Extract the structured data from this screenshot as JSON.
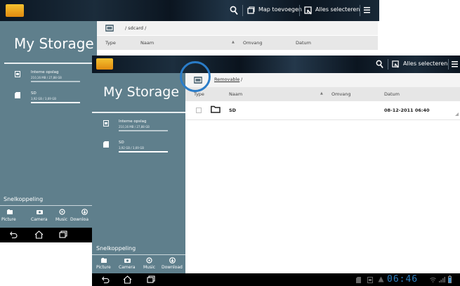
{
  "back": {
    "app_bar": {
      "action_add_folder": "Map toevoegen",
      "action_select_all": "Alles selecteren"
    },
    "sidebar": {
      "title": "My Storage",
      "storage": [
        {
          "label": "Interne opslag",
          "size": "210,16 MB / 27,88 GB",
          "fill": 0.01
        },
        {
          "label": "SD",
          "size": "3,92 GB / 3,69 GB",
          "fill": 0.95
        }
      ],
      "shortcuts_title": "Snelkoppeling",
      "shortcuts": [
        "Picture",
        "Camera",
        "Music",
        "Downloa"
      ]
    },
    "breadcrumb": "/ sdcard /",
    "columns": [
      "Type",
      "Naam",
      "Omvang",
      "Datum"
    ]
  },
  "front": {
    "app_bar": {
      "action_select_all": "Alles selecteren"
    },
    "sidebar": {
      "title": "My Storage",
      "storage": [
        {
          "label": "Interne opslag",
          "size": "210,16 MB / 27,88 GB",
          "fill": 0.01
        },
        {
          "label": "SD",
          "size": "3,92 GB / 3,69 GB",
          "fill": 0.95
        }
      ],
      "shortcuts_title": "Snelkoppeling",
      "shortcuts": [
        "Picture",
        "Camera",
        "Music",
        "Download"
      ]
    },
    "breadcrumb_link": "Removable",
    "breadcrumb_sep": "/",
    "columns": [
      "Type",
      "Naam",
      "Omvang",
      "Datum"
    ],
    "rows": [
      {
        "name": "SD",
        "date": "08-12-2011 06:40"
      }
    ],
    "status_time": "06:46"
  },
  "colors": {
    "sidebar": "#5f7f8c",
    "highlight_circle": "#2a7cc8",
    "appbar": "#0a1520",
    "navbar": "#000000",
    "accent_time": "#2f7fbf"
  },
  "icons": [
    "search-icon",
    "add-folder-icon",
    "select-all-icon",
    "menu-icon",
    "back-icon",
    "home-icon",
    "recent-apps-icon"
  ]
}
